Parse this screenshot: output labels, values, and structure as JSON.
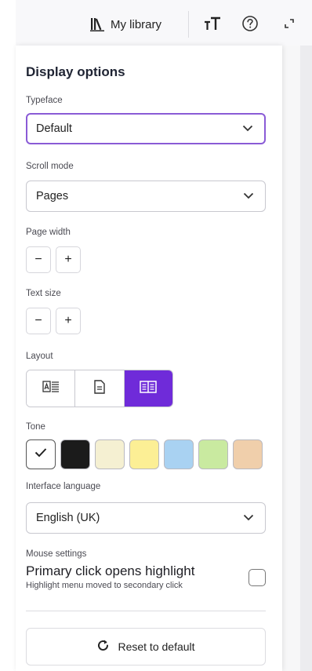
{
  "toolbar": {
    "library_label": "My library",
    "library_icon": "library-books-icon",
    "text_size_icon": "text-size-icon",
    "help_icon": "help-circle-icon",
    "fullscreen_icon": "expand-icon"
  },
  "panel": {
    "title": "Display options",
    "typeface": {
      "label": "Typeface",
      "value": "Default"
    },
    "scroll_mode": {
      "label": "Scroll mode",
      "value": "Pages"
    },
    "page_width": {
      "label": "Page width",
      "decrease": "−",
      "increase": "+"
    },
    "text_size": {
      "label": "Text size",
      "decrease": "−",
      "increase": "+"
    },
    "layout": {
      "label": "Layout",
      "options": [
        {
          "icon": "text-with-image-icon",
          "active": false
        },
        {
          "icon": "single-page-icon",
          "active": false
        },
        {
          "icon": "two-page-spread-icon",
          "active": true
        }
      ]
    },
    "tone": {
      "label": "Tone",
      "swatches": [
        "#ffffff",
        "#1b1b1b",
        "#f5f0d2",
        "#fcef95",
        "#a9d2f2",
        "#c9eaa0",
        "#f0cfab"
      ],
      "selected_index": 0
    },
    "interface_language": {
      "label": "Interface language",
      "value": "English (UK)"
    },
    "mouse_settings": {
      "label": "Mouse settings",
      "title": "Primary click opens highlight",
      "subtitle": "Highlight menu moved to secondary click",
      "checked": false
    },
    "reset_label": "Reset to default"
  },
  "colors": {
    "accent": "#6f2bd9",
    "focus_border": "#8a5bd6"
  }
}
